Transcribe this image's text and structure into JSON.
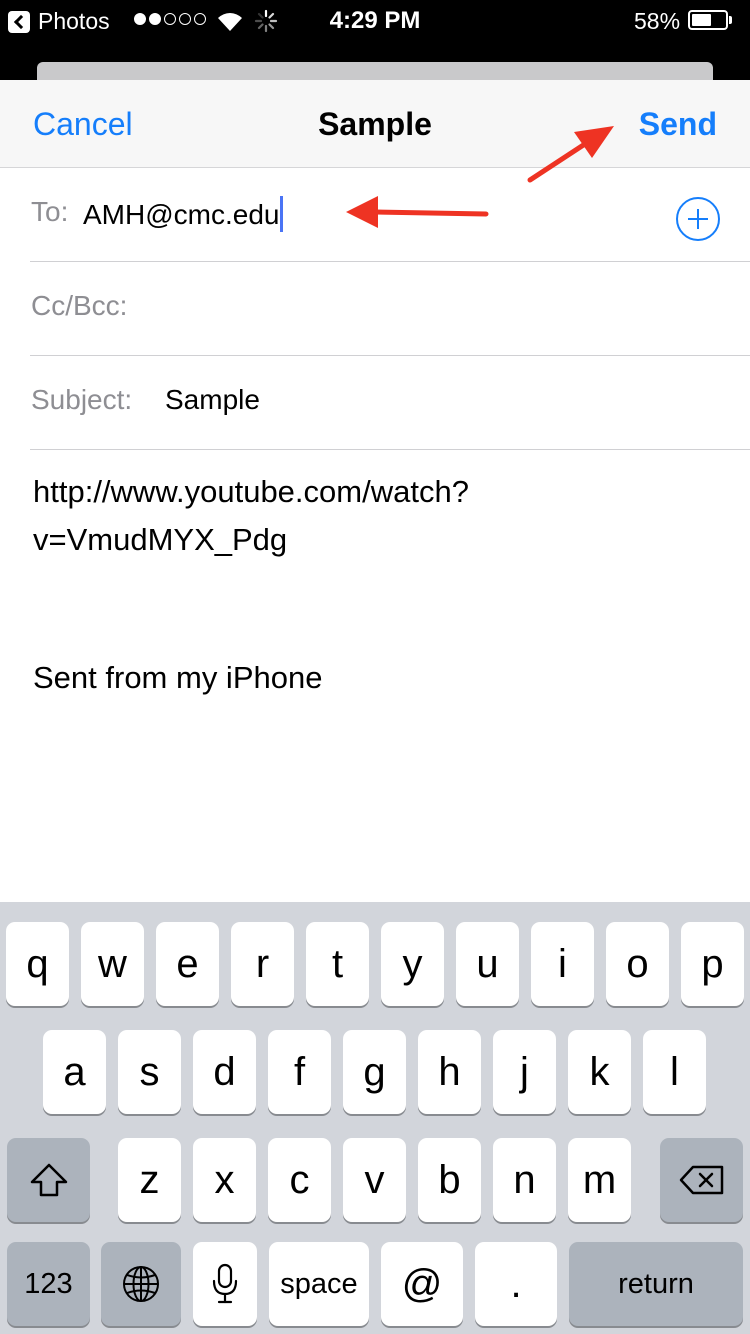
{
  "status_bar": {
    "back_app": "Photos",
    "time": "4:29 PM",
    "battery_percent": "58%",
    "battery_level": 0.58,
    "signal_dots": [
      true,
      true,
      false,
      false,
      false
    ]
  },
  "nav": {
    "cancel": "Cancel",
    "title": "Sample",
    "send": "Send"
  },
  "fields": {
    "to_label": "To:",
    "to_value": "AMH@cmc.edu",
    "ccbcc_label": "Cc/Bcc:",
    "subject_label": "Subject:",
    "subject_value": "Sample"
  },
  "body": {
    "lines": [
      "http://www.youtube.com/watch?",
      "v=VmudMYX_Pdg"
    ],
    "signature": "Sent from my iPhone"
  },
  "keyboard": {
    "row1": [
      "q",
      "w",
      "e",
      "r",
      "t",
      "y",
      "u",
      "i",
      "o",
      "p"
    ],
    "row2": [
      "a",
      "s",
      "d",
      "f",
      "g",
      "h",
      "j",
      "k",
      "l"
    ],
    "row3": [
      "z",
      "x",
      "c",
      "v",
      "b",
      "n",
      "m"
    ],
    "numbers": "123",
    "space": "space",
    "at": "@",
    "period": ".",
    "return": "return"
  },
  "colors": {
    "accent": "#157efb",
    "annotation_arrow": "#ee3323",
    "keyboard_bg": "#d2d5db"
  }
}
